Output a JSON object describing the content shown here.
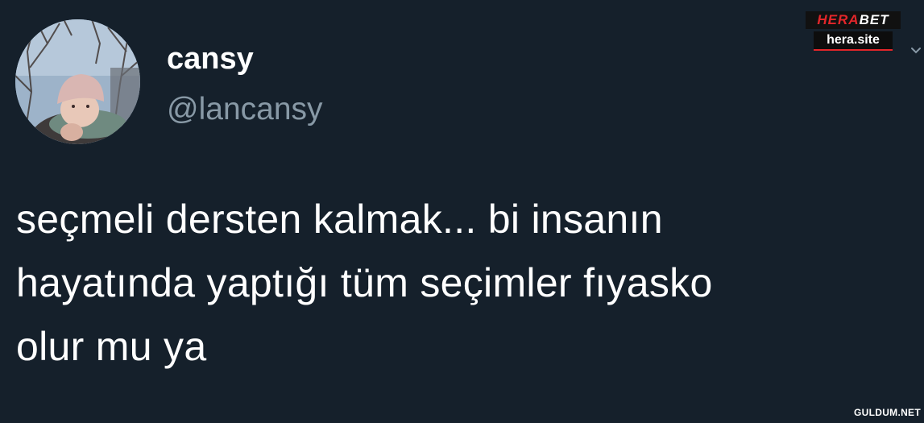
{
  "tweet": {
    "display_name": "cansy",
    "handle": "@lancansy",
    "text_lines": [
      "seçmeli dersten kalmak... bi insanın",
      "hayatında yaptığı tüm seçimler fıyasko",
      "olur mu ya"
    ],
    "icons": {
      "avatar": "profile-photo",
      "menu": "chevron-down-icon"
    }
  },
  "watermarks": {
    "top_brand_part1": "HERA",
    "top_brand_part2": "BET",
    "top_site": "hera.site",
    "bottom": "GULDUM.NET"
  },
  "colors": {
    "background": "#15202b",
    "primary_text": "#ffffff",
    "secondary_text": "#8899a6",
    "brand_red": "#e3262a"
  }
}
